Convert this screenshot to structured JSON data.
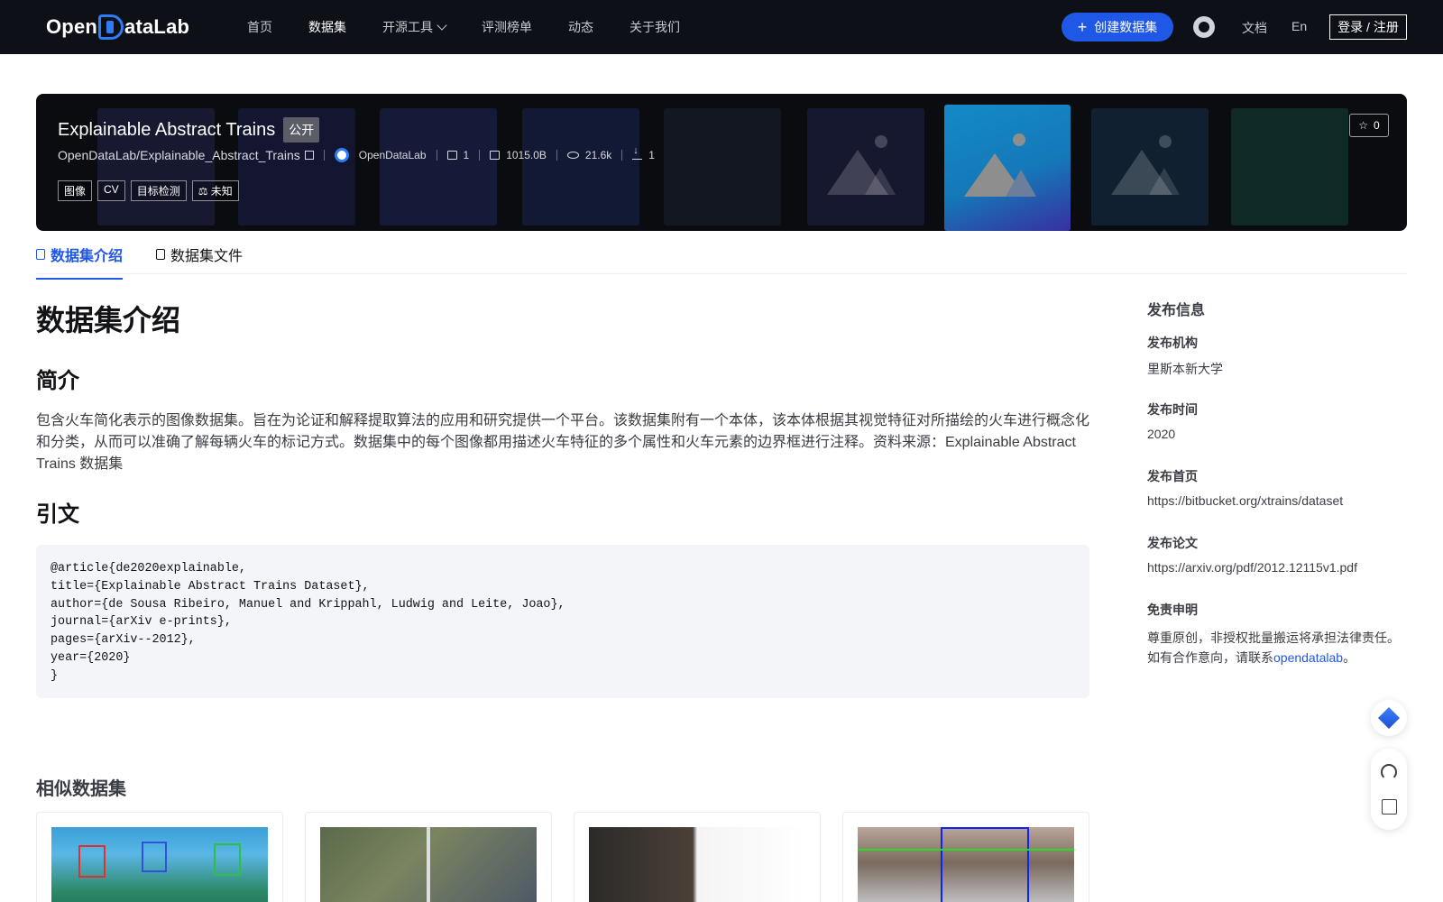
{
  "nav": {
    "logo_text_left": "Open",
    "logo_text_right": "ataLab",
    "links": [
      "首页",
      "数据集",
      "开源工具",
      "评测榜单",
      "动态",
      "关于我们"
    ],
    "active_link": "数据集",
    "create_button": "创建数据集",
    "docs": "文档",
    "lang": "En",
    "login": "登录 / 注册"
  },
  "dataset": {
    "title": "Explainable Abstract Trains",
    "visibility": "公开",
    "path": "OpenDataLab/Explainable_Abstract_Trains",
    "org": "OpenDataLab",
    "files_count": "1",
    "size": "1015.0B",
    "views": "21.6k",
    "downloads": "1",
    "tags": [
      "图像",
      "CV",
      "目标检测",
      "未知"
    ],
    "stars": "0"
  },
  "tabs": [
    "数据集介绍",
    "数据集文件"
  ],
  "content": {
    "heading": "数据集介绍",
    "intro_heading": "简介",
    "intro_text": "包含火车简化表示的图像数据集。旨在为论证和解释提取算法的应用和研究提供一个平台。该数据集附有一个本体，该本体根据其视觉特征对所描绘的火车进行概念化和分类，从而可以准确了解每辆火车的标记方式。数据集中的每个图像都用描述火车特征的多个属性和火车元素的边界框进行注释。资料来源：Explainable Abstract Trains 数据集",
    "citation_heading": "引文",
    "citation": "@article{de2020explainable,\ntitle={Explainable Abstract Trains Dataset},\nauthor={de Sousa Ribeiro, Manuel and Krippahl, Ludwig and Leite, Joao},\njournal={arXiv e-prints},\npages={arXiv--2012},\nyear={2020}\n}"
  },
  "sidebar": {
    "title": "发布信息",
    "org_label": "发布机构",
    "org_value": "里斯本新大学",
    "time_label": "发布时间",
    "time_value": "2020",
    "home_label": "发布首页",
    "home_value": "https://bitbucket.org/xtrains/dataset",
    "paper_label": "发布论文",
    "paper_value": "https://arxiv.org/pdf/2012.12115v1.pdf",
    "disclaimer_label": "免责申明",
    "disclaimer_line1": "尊重原创，非授权批量搬运将承担法律责任。",
    "disclaimer_line2_pre": "如有合作意向，请联系",
    "disclaimer_link": "opendatalab",
    "disclaimer_line2_post": "。"
  },
  "similar": {
    "title": "相似数据集"
  },
  "colors": {
    "nav_bg": "#0d1117",
    "accent": "#1f57e6",
    "banner_bg": "#0b0c10"
  }
}
